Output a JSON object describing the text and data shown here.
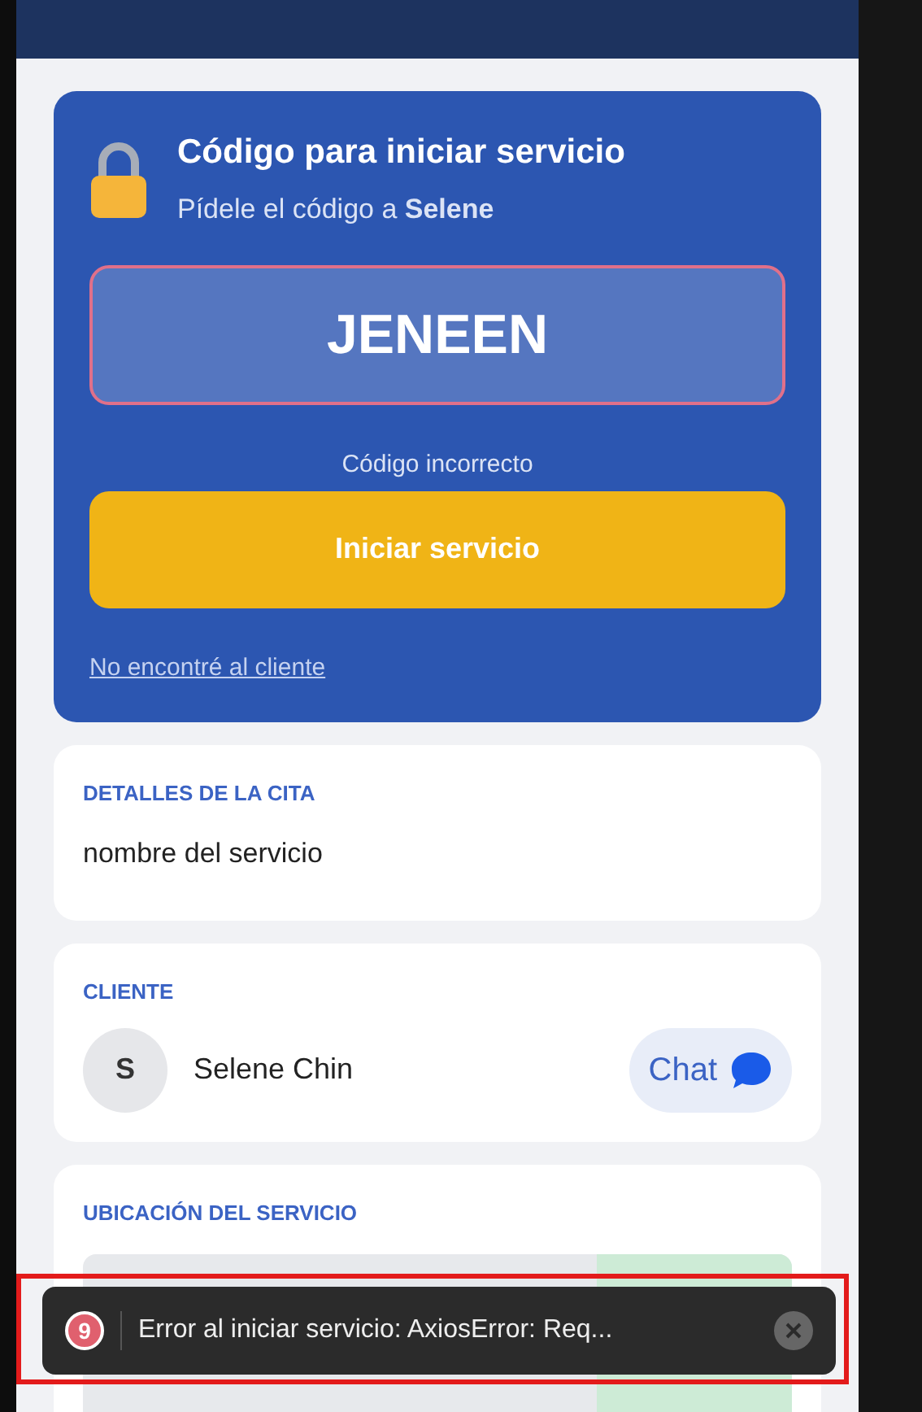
{
  "code_card": {
    "title": "Código para iniciar servicio",
    "subtitle": "Pídele el código a **Selene**",
    "code_value": "JENEEN",
    "invalid": true,
    "error": "Código incorrecto",
    "start_button": "Iniciar servicio",
    "link": "No encontré al cliente"
  },
  "details": {
    "heading": "DETALLES DE LA CITA",
    "service_name": "nombre del servicio"
  },
  "client": {
    "heading": "CLIENTE",
    "initial": "S",
    "name": "Selene Chin",
    "chat_button": "Chat"
  },
  "location": {
    "heading": "UBICACIÓN DEL SERVICIO"
  },
  "toast": {
    "count": "9",
    "message": "Error al iniciar servicio: AxiosError: Req...",
    "highlighted": true
  }
}
